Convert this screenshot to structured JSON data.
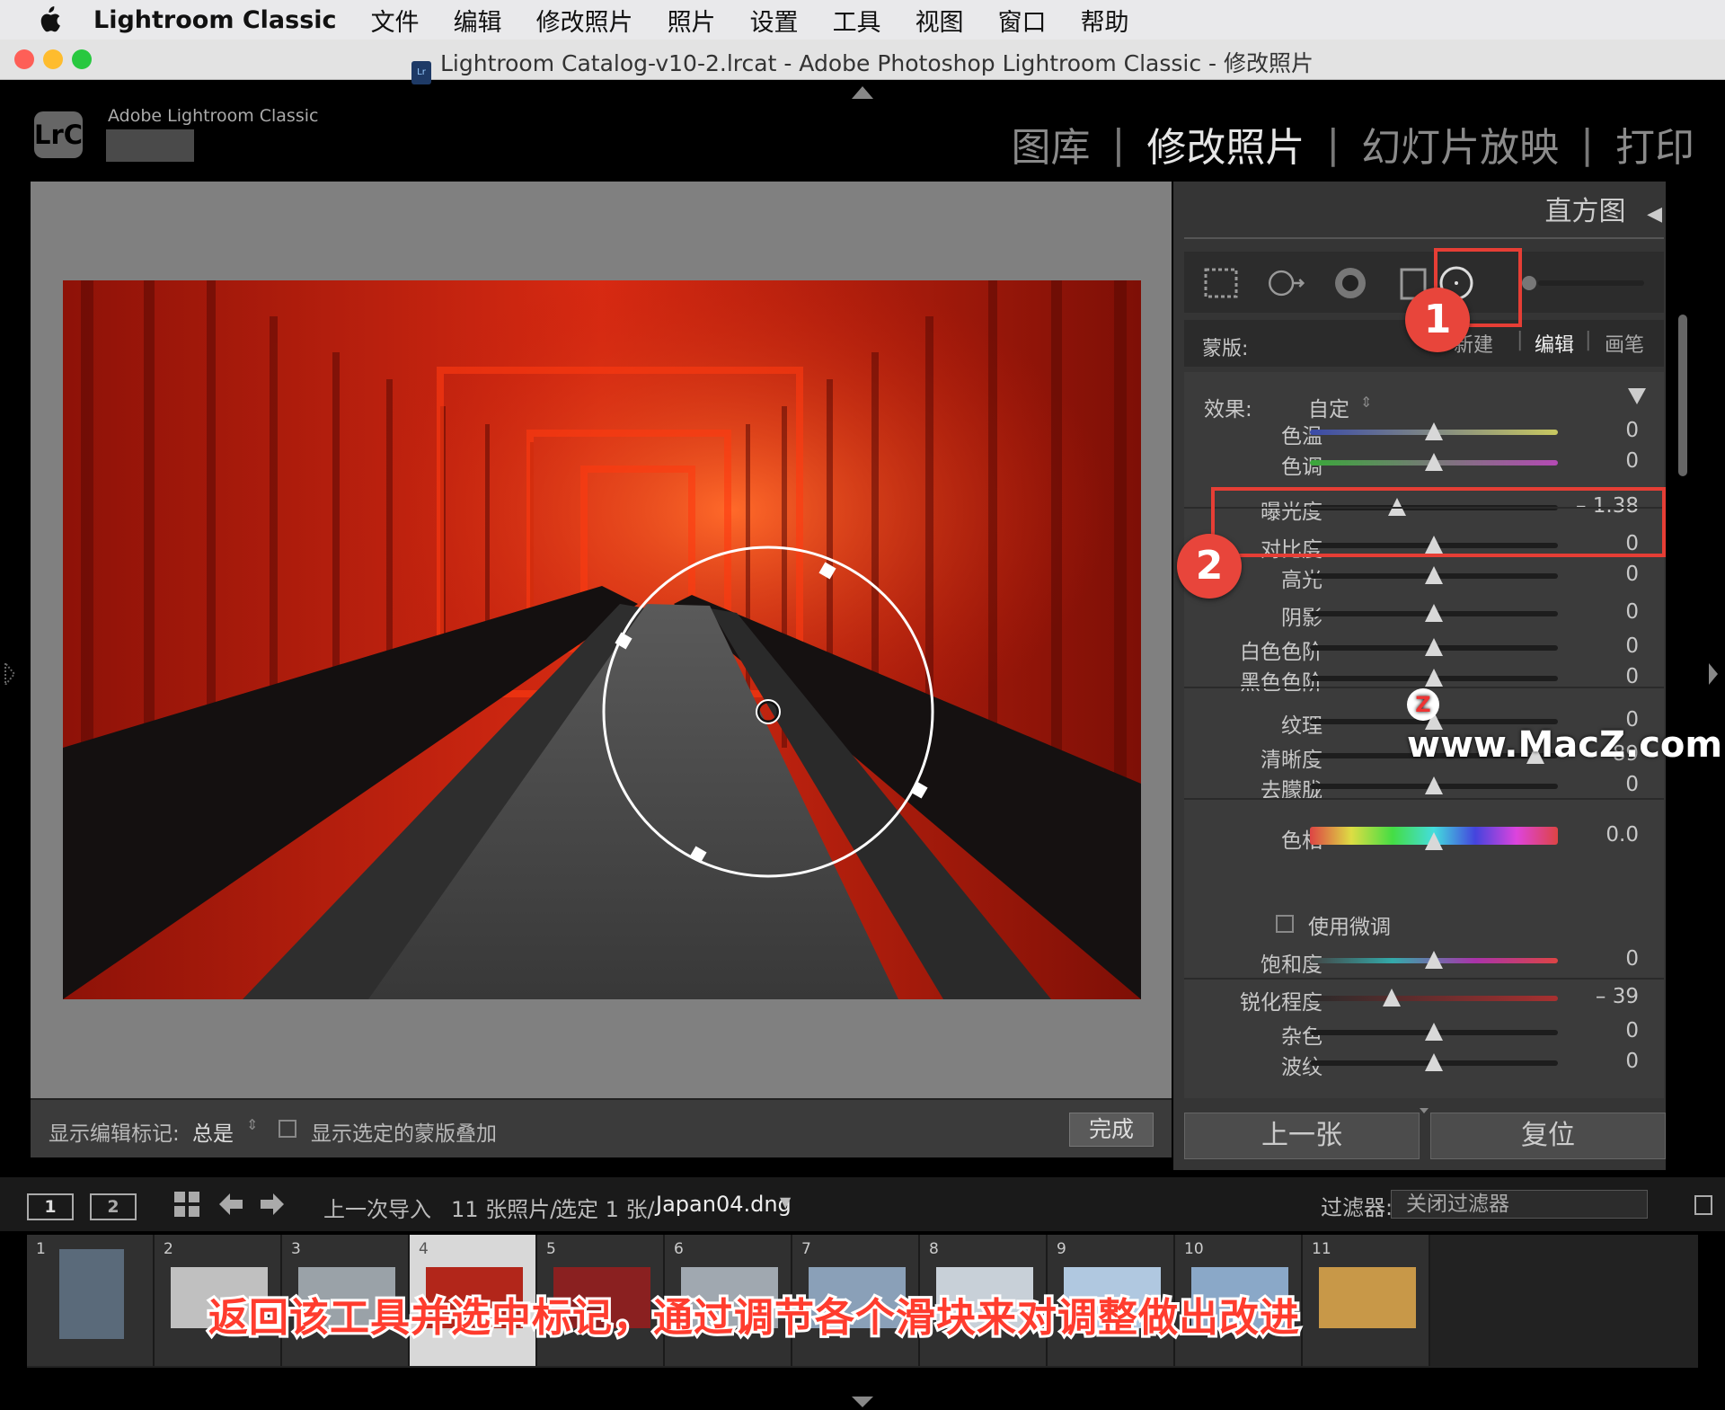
{
  "menubar": {
    "app": "Lightroom Classic",
    "items": [
      "文件",
      "编辑",
      "修改照片",
      "照片",
      "设置",
      "工具",
      "视图",
      "窗口",
      "帮助"
    ]
  },
  "window": {
    "title": "Lightroom Catalog-v10-2.lrcat - Adobe Photoshop Lightroom Classic - 修改照片"
  },
  "header": {
    "logo": "LrC",
    "brand": "Adobe Lightroom Classic",
    "modules": [
      {
        "label": "图库",
        "active": false
      },
      {
        "label": "修改照片",
        "active": true
      },
      {
        "label": "幻灯片放映",
        "active": false
      },
      {
        "label": "打印",
        "active": false
      }
    ]
  },
  "right_panel": {
    "histogram_label": "直方图",
    "mask_label": "蒙版:",
    "mask_tabs": [
      "新建",
      "编辑",
      "画笔"
    ],
    "effect_label": "效果:",
    "effect_value": "自定",
    "sliders": [
      {
        "label": "色温",
        "value": "0",
        "pos": 0.5,
        "track": "temp"
      },
      {
        "label": "色调",
        "value": "0",
        "pos": 0.5,
        "track": "tint"
      },
      {
        "label": "曝光度",
        "value": "– 1.38",
        "pos": 0.35,
        "track": "gray"
      },
      {
        "label": "对比度",
        "value": "0",
        "pos": 0.5,
        "track": "gray"
      },
      {
        "label": "高光",
        "value": "0",
        "pos": 0.5,
        "track": "gray"
      },
      {
        "label": "阴影",
        "value": "0",
        "pos": 0.5,
        "track": "gray"
      },
      {
        "label": "白色色阶",
        "value": "0",
        "pos": 0.5,
        "track": "gray"
      },
      {
        "label": "黑色色阶",
        "value": "0",
        "pos": 0.5,
        "track": "gray"
      },
      {
        "label": "纹理",
        "value": "0",
        "pos": 0.5,
        "track": "gray"
      },
      {
        "label": "清晰度",
        "value": "89",
        "pos": 0.91,
        "track": "gray"
      },
      {
        "label": "去朦胧",
        "value": "0",
        "pos": 0.5,
        "track": "gray"
      },
      {
        "label": "色相",
        "value": "0.0",
        "pos": 0.5,
        "track": "hue"
      },
      {
        "label": "饱和度",
        "value": "0",
        "pos": 0.5,
        "track": "sat"
      },
      {
        "label": "锐化程度",
        "value": "– 39",
        "pos": 0.33,
        "track": "sharp"
      },
      {
        "label": "杂色",
        "value": "0",
        "pos": 0.5,
        "track": "gray"
      },
      {
        "label": "波纹",
        "value": "0",
        "pos": 0.5,
        "track": "gray"
      }
    ],
    "fine_tune_label": "使用微调",
    "prev_button": "上一张",
    "reset_button": "复位"
  },
  "toolbar": {
    "show_markers_label": "显示编辑标记:",
    "show_markers_value": "总是",
    "overlay_label": "显示选定的蒙版叠加",
    "done_button": "完成"
  },
  "filmstrip_bar": {
    "page1": "1",
    "page2": "2",
    "source": "上一次导入",
    "count": "11 张照片/",
    "selected": "选定 1 张/",
    "filename": "Japan04.dng",
    "filter_label": "过滤器:",
    "filter_value": "关闭过滤器"
  },
  "filmstrip": {
    "numbers": [
      "1",
      "2",
      "3",
      "4",
      "5",
      "6",
      "7",
      "8",
      "9",
      "10",
      "11"
    ],
    "active_index": 4
  },
  "annotations": {
    "badge1": "1",
    "badge2": "2",
    "caption": "返回该工具并选中标记，通过调节各个滑块来对调整做出改进",
    "watermark": "www.MacZ.com",
    "watermark_logo": "Z"
  },
  "colors": {
    "accent_red": "#e63e35",
    "panel_bg": "#3b3b3b",
    "photo_red": "#c8200f"
  }
}
